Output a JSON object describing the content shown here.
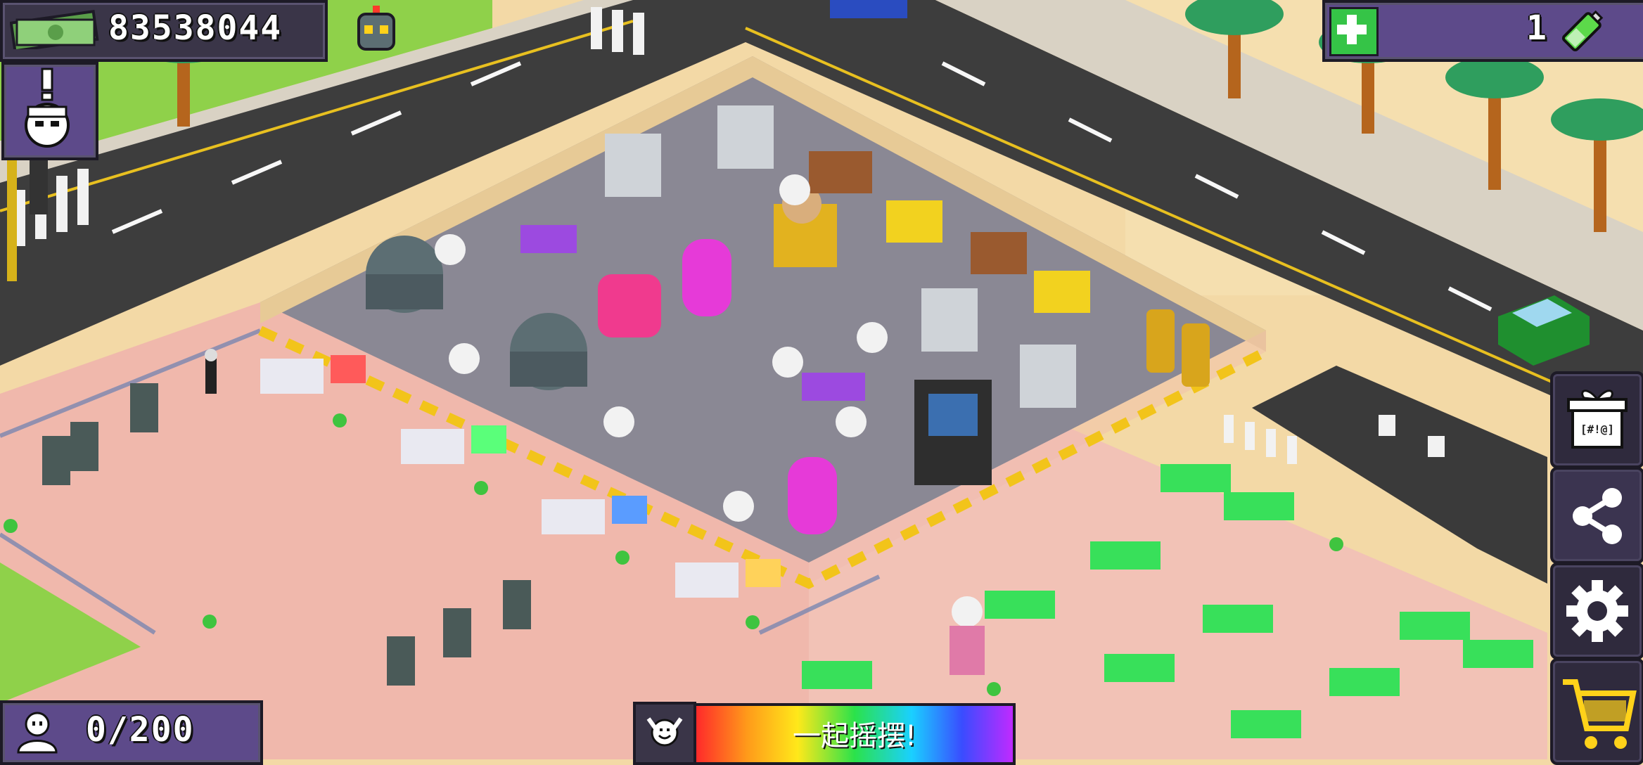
{
  "hud": {
    "money": "83538044",
    "batteries": "1",
    "visitors": "0/200",
    "dance_label": "一起摇摆!"
  },
  "icons": {
    "cash": "cash-icon",
    "robot": "robot-icon",
    "manager": "manager-alert-icon",
    "plus": "plus-icon",
    "battery": "battery-icon",
    "gift": "gift-icon",
    "share": "share-icon",
    "settings": "gear-icon",
    "shop": "cart-icon",
    "visitor": "person-icon",
    "dance": "dance-icon"
  },
  "colors": {
    "hud_panel": "#3a3548",
    "hud_purple": "#5d4a8a",
    "plus_green": "#35c447",
    "floor_pink": "#f0b8ac",
    "road": "#3d3d3d",
    "grass": "#8fd14a"
  },
  "gift_label": "[#!@]"
}
